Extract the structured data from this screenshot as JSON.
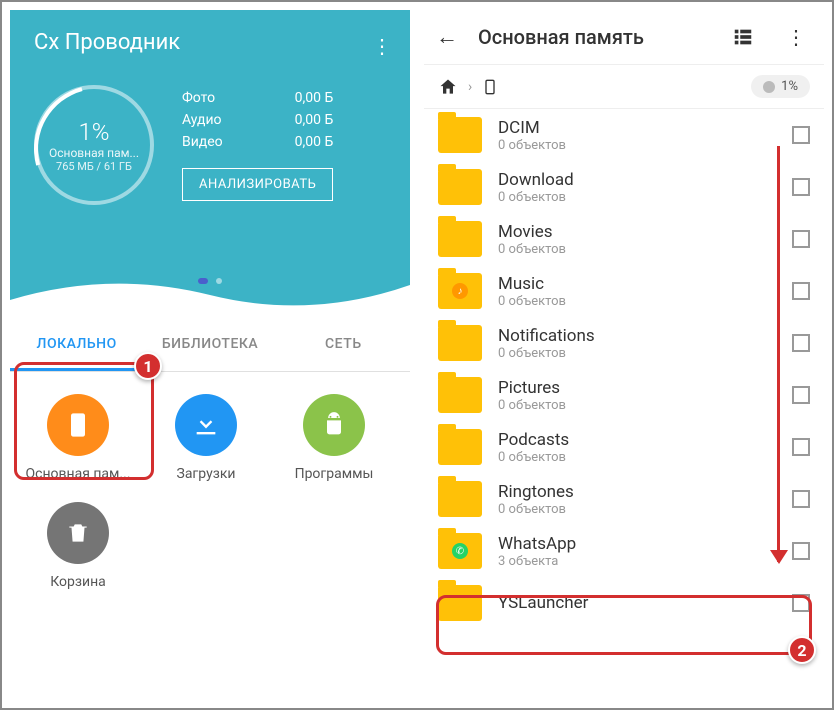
{
  "left": {
    "app_title": "Cx Проводник",
    "storage": {
      "percent": "1%",
      "label": "Основная пам...",
      "size": "765 МБ / 61 ГБ"
    },
    "stats": {
      "photo_label": "Фото",
      "photo_val": "0,00 Б",
      "audio_label": "Аудио",
      "audio_val": "0,00 Б",
      "video_label": "Видео",
      "video_val": "0,00 Б"
    },
    "analyze_btn": "АНАЛИЗИРОВАТЬ",
    "tabs": {
      "local": "ЛОКАЛЬНО",
      "library": "БИБЛИОТЕКА",
      "network": "СЕТЬ"
    },
    "items": {
      "storage": "Основная пам...",
      "downloads": "Загрузки",
      "apps": "Программы",
      "trash": "Корзина"
    }
  },
  "right": {
    "title": "Основная память",
    "storage_pct": "1%",
    "folders": [
      {
        "name": "DCIM",
        "sub": "0 объектов",
        "badge": null
      },
      {
        "name": "Download",
        "sub": "0 объектов",
        "badge": null
      },
      {
        "name": "Movies",
        "sub": "0 объектов",
        "badge": null
      },
      {
        "name": "Music",
        "sub": "0 объектов",
        "badge": "♪"
      },
      {
        "name": "Notifications",
        "sub": "0 объектов",
        "badge": null
      },
      {
        "name": "Pictures",
        "sub": "0 объектов",
        "badge": null
      },
      {
        "name": "Podcasts",
        "sub": "0 объектов",
        "badge": null
      },
      {
        "name": "Ringtones",
        "sub": "0 объектов",
        "badge": null
      },
      {
        "name": "WhatsApp",
        "sub": "3 объекта",
        "badge": "wa"
      },
      {
        "name": "YSLauncher",
        "sub": "",
        "badge": null
      }
    ]
  },
  "annotations": {
    "badge1": "1",
    "badge2": "2"
  }
}
